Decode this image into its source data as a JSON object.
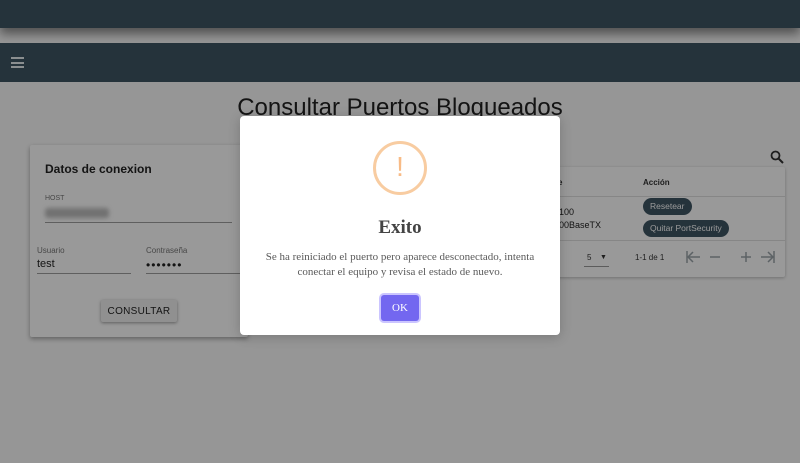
{
  "header": {
    "menu_icon": "hamburger-menu-icon",
    "page_title": "Consultar Puertos Bloqueados"
  },
  "connection": {
    "title": "Datos de conexion",
    "host_label": "HOST",
    "user_label": "Usuario",
    "user_value": "test",
    "password_label": "Contraseña",
    "password_value": "•••••••",
    "submit_label": "CONSULTAR"
  },
  "table": {
    "search_icon": "search-icon",
    "col_partial": "e",
    "col_action": "Acción",
    "row_line1": "100",
    "row_line2": "00BaseTX",
    "actions": [
      "Resetear",
      "Quitar PortSecurity"
    ],
    "pager": {
      "rows_label_partial": "a:",
      "rows_value": "5",
      "range": "1-1 de 1"
    }
  },
  "modal": {
    "icon": "warning-exclamation-icon",
    "icon_glyph": "!",
    "title": "Exito",
    "message": "Se ha reiniciado el puerto pero aparece desconectado, intenta conectar el equipo y revisa el estado de nuevo.",
    "ok_label": "OK"
  },
  "colors": {
    "toolbar": "#3e5563",
    "ok_button": "#7367f0",
    "warning": "#f8bb86"
  }
}
